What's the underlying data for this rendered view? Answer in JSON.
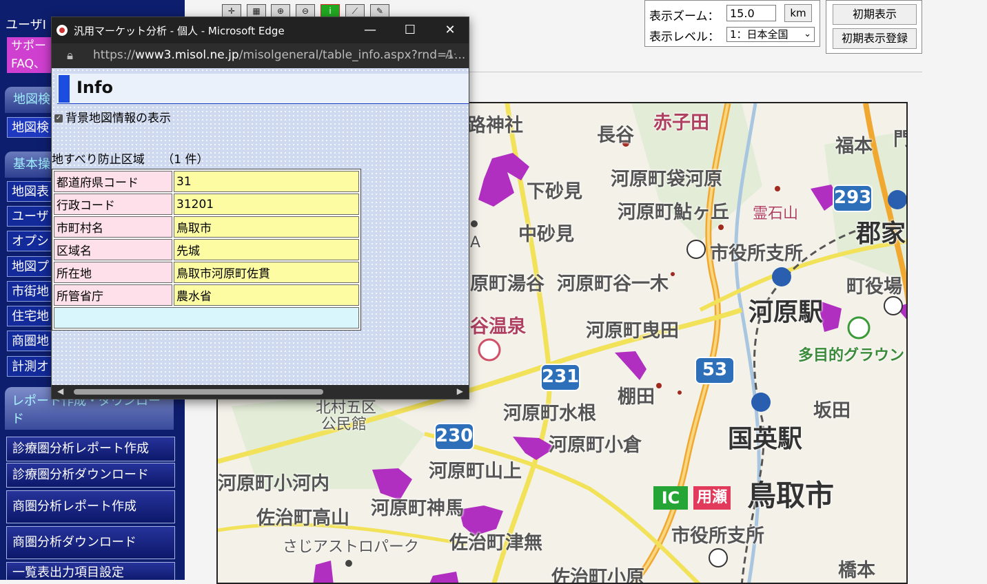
{
  "sidebar": {
    "title": "ユーザI",
    "support": [
      "サポー",
      "FAQ、"
    ],
    "section_map_search": "地図検",
    "item_map_search": "地図検",
    "section_basic": "基本操",
    "items": [
      "地図表",
      "ユーザ",
      "オプシ",
      "地図プ",
      "市街地",
      "住宅地",
      "商圏地",
      "計測オ"
    ],
    "report_section": "レポート作成・ダウンロード",
    "buttons": [
      "診療圏分析レポート作成",
      "診療圏分析ダウンロード",
      "商圏分析レポート作成",
      "商圏分析ダウンロード",
      "一覧表出力項目設定"
    ]
  },
  "toolbar": {
    "zoom_label": "表示ズーム：",
    "zoom_value": "15.0",
    "zoom_unit": "km",
    "level_label": "表示レベル：",
    "level_selected": "1：日本全国",
    "init_display": "初期表示",
    "init_register": "初期表示登録"
  },
  "popup": {
    "window_title": "汎用マーケット分析 - 個人 - Microsoft Edge",
    "url_prefix": "https://",
    "url_host": "www3.misol.ne.jp",
    "url_path": "/misolgeneral/table_info.aspx?rnd=1...",
    "header": "Info",
    "checkbox_label": "背景地図情報の表示",
    "section_title": "地すべり防止区域　　（1 件）",
    "rows": [
      {
        "key": "都道府県コード",
        "value": "31"
      },
      {
        "key": "行政コード",
        "value": "31201"
      },
      {
        "key": "市町村名",
        "value": "鳥取市"
      },
      {
        "key": "区域名",
        "value": "先城"
      },
      {
        "key": "所在地",
        "value": "鳥取市河原町佐貫"
      },
      {
        "key": "所管省庁",
        "value": "農水省"
      }
    ]
  },
  "map": {
    "labels": {
      "l1": "路神社",
      "l2": "赤子田",
      "l3": "長谷",
      "l4": "福本",
      "l5": "門",
      "l6": "下砂見",
      "l7": "河原町袋河原",
      "l8": "河原町鮎ヶ丘",
      "l9": "霊石山",
      "l10": "中砂見",
      "l11": "市役所支所",
      "l12": "郡家",
      "l13": "原町湯谷",
      "l14": "河原町谷一木",
      "l15": "町役場",
      "l16": "河原駅",
      "l17": "谷温泉",
      "l18": "河原町曳田",
      "l19": "多目的グラウン",
      "l20": "棚田",
      "l21": "河原町水根",
      "l22": "坂田",
      "l23": "北村五区",
      "l24": "公民館",
      "l25": "河原町小倉",
      "l26": "国英駅",
      "l27": "河原町山上",
      "l28": "河原町小河内",
      "l29": "河原町神馬",
      "l30": "鳥取市",
      "l31": "佐治町高山",
      "l32": "さじアストロパーク",
      "l33": "佐治町津無",
      "l34": "市役所支所",
      "l35": "佐治町小原",
      "l36": "橋本",
      "l37": "A"
    },
    "shields": {
      "s231": "231",
      "s53": "53",
      "s230": "230",
      "s293": "293"
    },
    "badges": {
      "ic": "IC",
      "yose": "用瀬"
    },
    "colors": {
      "landslide": "#b02fc0",
      "road_yellow": "#f2e25a",
      "road_orange": "#f0a830",
      "forest": "#dce8cf"
    }
  }
}
